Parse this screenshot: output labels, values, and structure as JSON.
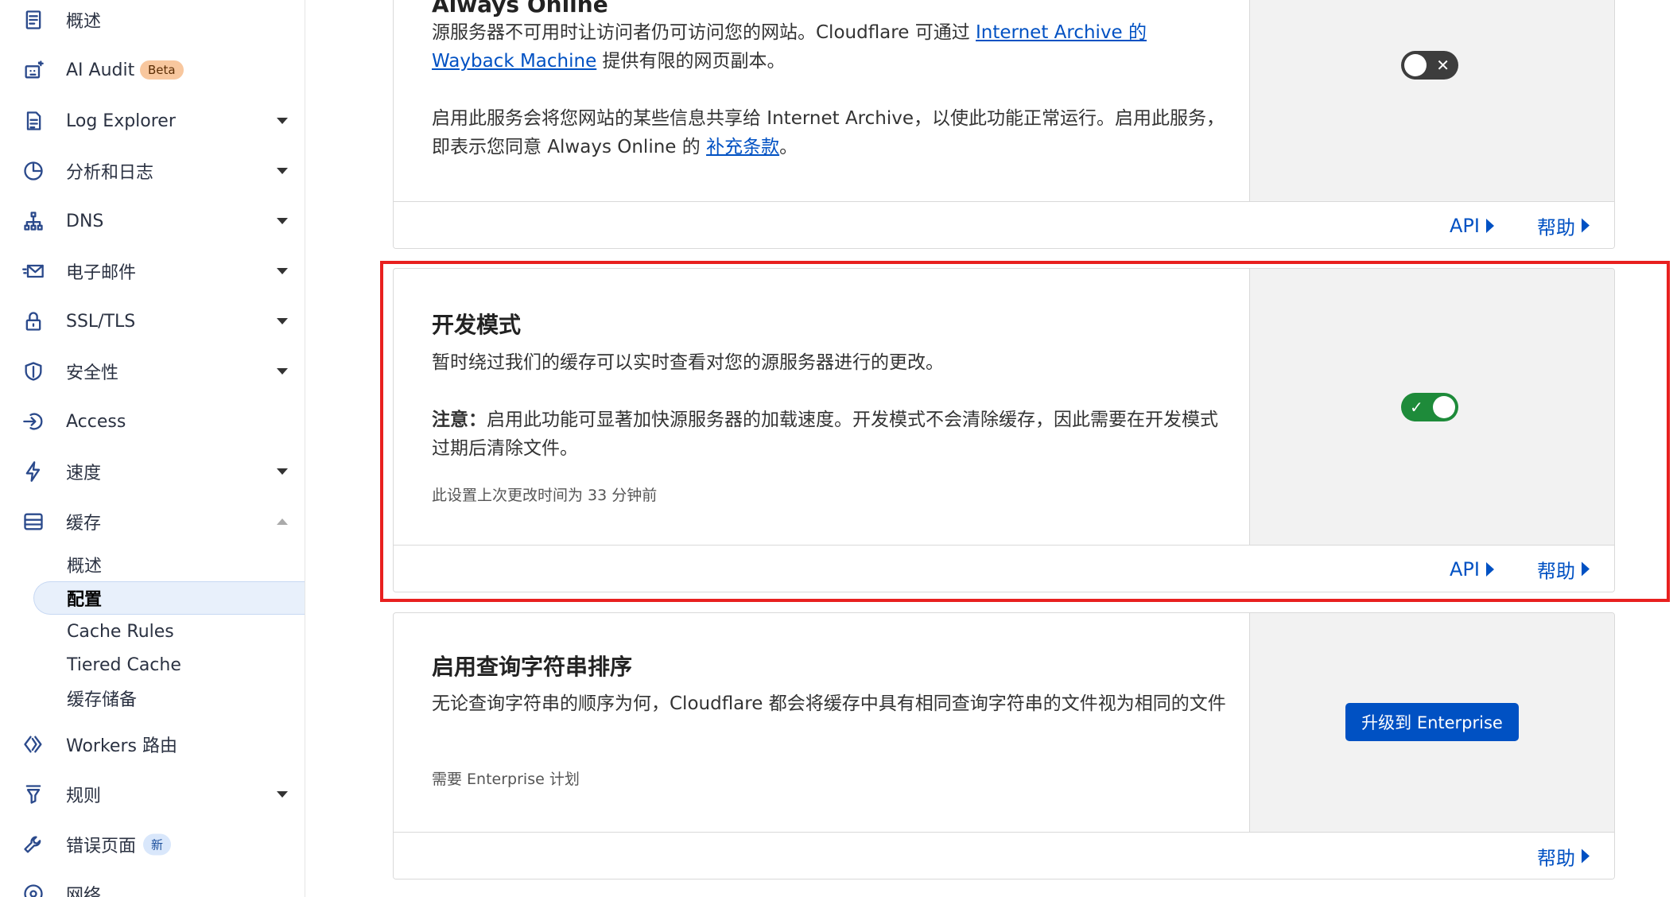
{
  "sidebar": {
    "items": [
      {
        "label": "概述"
      },
      {
        "label": "AI Audit",
        "badge": "Beta"
      },
      {
        "label": "Log Explorer"
      },
      {
        "label": "分析和日志"
      },
      {
        "label": "DNS"
      },
      {
        "label": "电子邮件"
      },
      {
        "label": "SSL/TLS"
      },
      {
        "label": "安全性"
      },
      {
        "label": "Access"
      },
      {
        "label": "速度"
      },
      {
        "label": "缓存"
      },
      {
        "label": "Workers 路由"
      },
      {
        "label": "规则"
      },
      {
        "label": "错误页面",
        "badge": "新"
      },
      {
        "label": "网络"
      }
    ],
    "cache_sub": [
      {
        "label": "概述"
      },
      {
        "label": "配置"
      },
      {
        "label": "Cache Rules"
      },
      {
        "label": "Tiered Cache"
      },
      {
        "label": "缓存储备"
      }
    ]
  },
  "cards": {
    "always_online": {
      "title": "Always Online",
      "p1_a": "源服务器不可用时让访问者仍可访问您的网站。Cloudflare 可通过 ",
      "p1_link": "Internet Archive 的 Wayback Machine",
      "p1_b": " 提供有限的网页副本。",
      "p2_a": "启用此服务会将您网站的某些信息共享给 Internet Archive，以使此功能正常运行。启用此服务，即表示您同意 Always Online 的 ",
      "p2_link": "补充条款",
      "p2_b": "。",
      "api": "API",
      "help": "帮助",
      "toggle_state": "off",
      "toggle_symbol": "✕"
    },
    "dev_mode": {
      "title": "开发模式",
      "desc": "暂时绕过我们的缓存可以实时查看对您的源服务器进行的更改。",
      "note_label": "注意：",
      "note_text": "启用此功能可显著加快源服务器的加载速度。开发模式不会清除缓存，因此需要在开发模式过期后清除文件。",
      "meta": "此设置上次更改时间为 33 分钟前",
      "api": "API",
      "help": "帮助",
      "toggle_state": "on",
      "toggle_symbol": "✓"
    },
    "query_sort": {
      "title": "启用查询字符串排序",
      "desc": "无论查询字符串的顺序为何，Cloudflare 都会将缓存中具有相同查询字符串的文件视为相同的文件",
      "meta": "需要 Enterprise 计划",
      "button": "升级到 Enterprise",
      "help": "帮助"
    }
  },
  "colors": {
    "accent": "#0051c3",
    "toggle_on": "#1e8b3a",
    "toggle_off": "#3d3d3d",
    "highlight": "#e8201f"
  }
}
